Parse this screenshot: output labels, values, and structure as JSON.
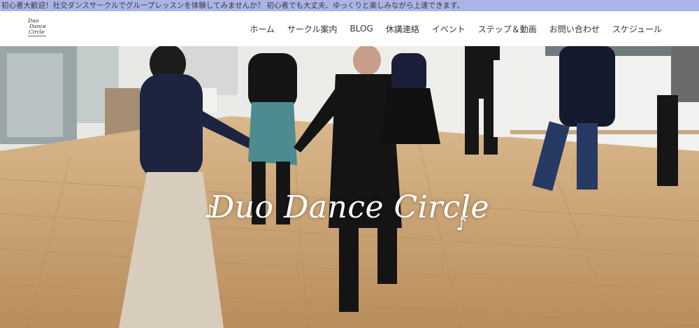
{
  "announcement": "初心者大歓迎！社交ダンスサークルでグループレッスンを体験してみませんか？ 初心者でも大丈夫、ゆっくりと楽しみながら上達できます。",
  "logo": {
    "line1": "Duo",
    "line2": "Dance",
    "line3": "Circle"
  },
  "nav": {
    "items": [
      {
        "label": "ホーム"
      },
      {
        "label": "サークル案内"
      },
      {
        "label": "BLOG"
      },
      {
        "label": "休講連絡"
      },
      {
        "label": "イベント"
      },
      {
        "label": "ステップ＆動画"
      },
      {
        "label": "お問い合わせ"
      },
      {
        "label": "スケジュール"
      }
    ]
  },
  "hero": {
    "title": "Duo Dance Circle",
    "note_glyph": "♪"
  },
  "colors": {
    "announce_bg": "#aab4e6",
    "floor": "#c9a57a",
    "wall": "#eeeeec"
  }
}
